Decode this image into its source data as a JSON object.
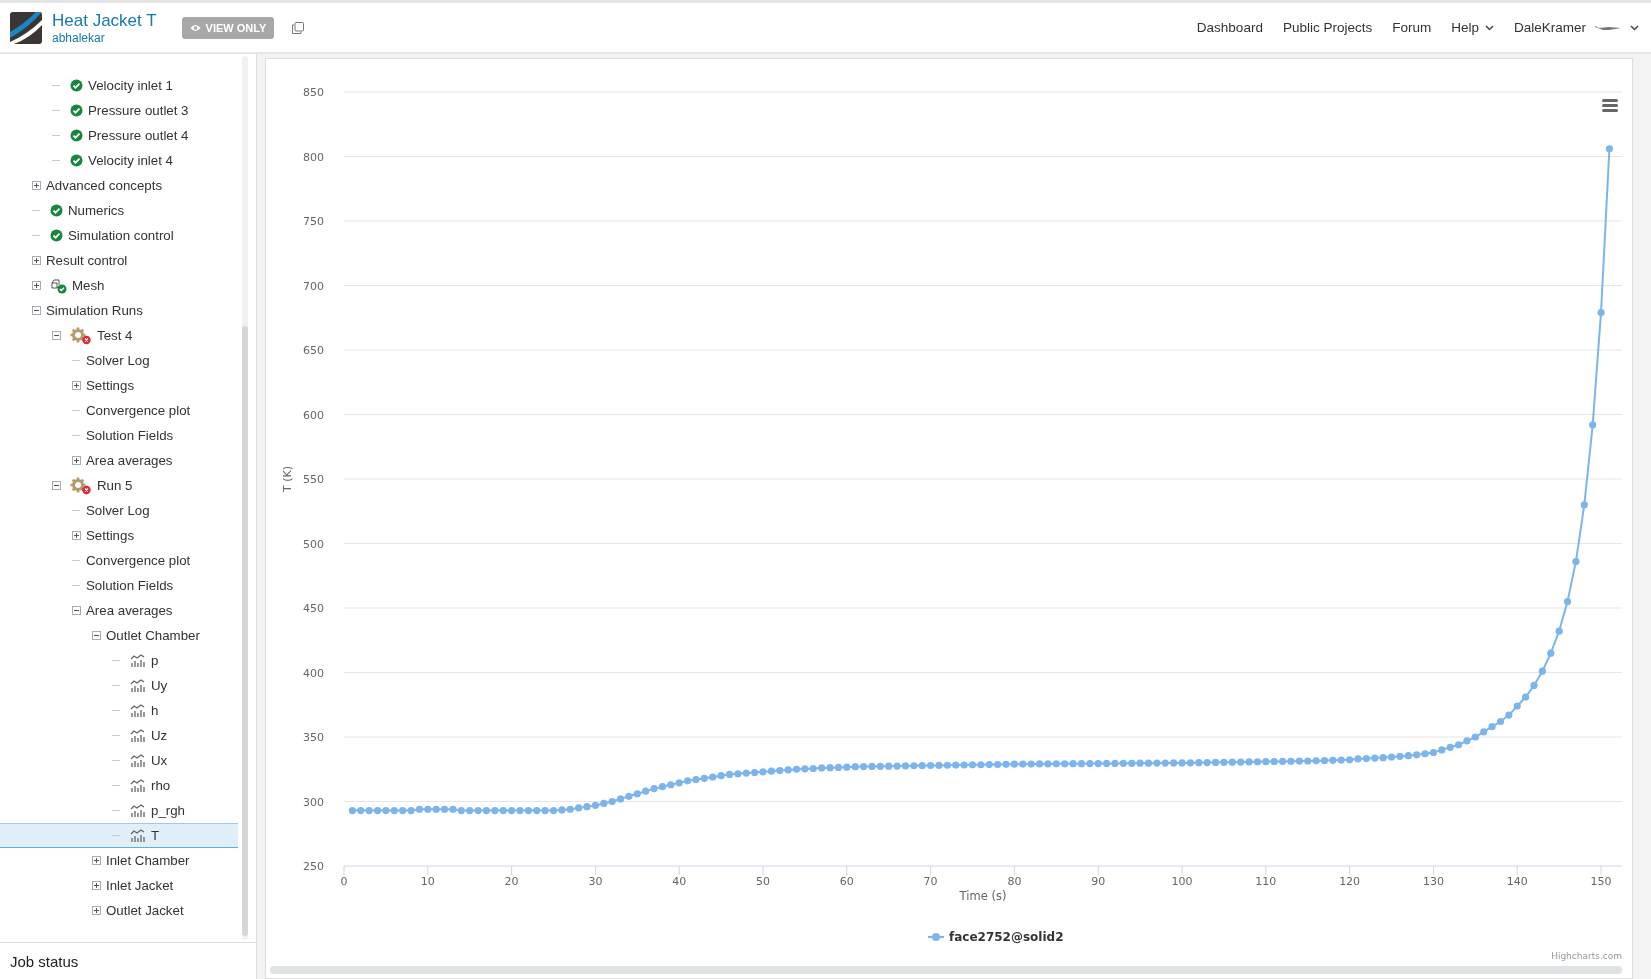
{
  "header": {
    "title": "Heat Jacket T",
    "subtitle": "abhalekar",
    "badge": "VIEW ONLY",
    "nav": [
      {
        "label": "Dashboard",
        "kind": "link"
      },
      {
        "label": "Public Projects",
        "kind": "link"
      },
      {
        "label": "Forum",
        "kind": "link"
      },
      {
        "label": "Help",
        "kind": "menu"
      },
      {
        "label": "DaleKramer",
        "kind": "user"
      }
    ]
  },
  "tree": {
    "items": [
      {
        "kind": "group",
        "children": [
          {
            "label": "Velocity inlet 1",
            "kind": "check",
            "selected": false
          },
          {
            "label": "Pressure outlet 3",
            "kind": "check",
            "selected": false
          },
          {
            "label": "Pressure outlet 4",
            "kind": "check",
            "selected": false
          },
          {
            "label": "Velocity inlet 4",
            "kind": "check",
            "selected": false
          }
        ]
      },
      {
        "label": "Advanced concepts",
        "expanded": false,
        "selected": false
      },
      {
        "label": "Numerics",
        "kind": "check",
        "selected": false
      },
      {
        "label": "Simulation control",
        "kind": "check",
        "selected": false
      },
      {
        "label": "Result control",
        "expanded": false,
        "selected": false
      },
      {
        "label": "Mesh",
        "kind": "mesh",
        "expanded": false,
        "selected": false
      },
      {
        "label": "Simulation Runs",
        "expanded": true,
        "selected": false,
        "children": [
          {
            "label": "Test 4",
            "kind": "run-error",
            "expanded": true,
            "selected": false,
            "children": [
              {
                "label": "Solver Log",
                "selected": false
              },
              {
                "label": "Settings",
                "expanded": false,
                "selected": false
              },
              {
                "label": "Convergence plot",
                "selected": false
              },
              {
                "label": "Solution Fields",
                "selected": false
              },
              {
                "label": "Area averages",
                "expanded": false,
                "selected": false
              }
            ]
          },
          {
            "label": "Run 5",
            "kind": "run-error",
            "expanded": true,
            "selected": false,
            "children": [
              {
                "label": "Solver Log",
                "selected": false
              },
              {
                "label": "Settings",
                "expanded": false,
                "selected": false
              },
              {
                "label": "Convergence plot",
                "selected": false
              },
              {
                "label": "Solution Fields",
                "selected": false
              },
              {
                "label": "Area averages",
                "expanded": true,
                "selected": false,
                "children": [
                  {
                    "label": "Outlet Chamber",
                    "expanded": true,
                    "selected": false,
                    "children": [
                      {
                        "label": "p",
                        "kind": "plot",
                        "selected": false
                      },
                      {
                        "label": "Uy",
                        "kind": "plot",
                        "selected": false
                      },
                      {
                        "label": "h",
                        "kind": "plot",
                        "selected": false
                      },
                      {
                        "label": "Uz",
                        "kind": "plot",
                        "selected": false
                      },
                      {
                        "label": "Ux",
                        "kind": "plot",
                        "selected": false
                      },
                      {
                        "label": "rho",
                        "kind": "plot",
                        "selected": false
                      },
                      {
                        "label": "p_rgh",
                        "kind": "plot",
                        "selected": false
                      },
                      {
                        "label": "T",
                        "kind": "plot",
                        "selected": true
                      }
                    ]
                  },
                  {
                    "label": "Inlet Chamber",
                    "expanded": false,
                    "selected": false
                  },
                  {
                    "label": "Inlet Jacket",
                    "expanded": false,
                    "selected": false
                  },
                  {
                    "label": "Outlet Jacket",
                    "expanded": false,
                    "selected": false
                  }
                ]
              }
            ]
          }
        ]
      }
    ]
  },
  "job_status": "Job status",
  "chart": {
    "credit": "Highcharts.com",
    "chart_data": {
      "type": "line",
      "grid": true,
      "xlabel": "Time (s)",
      "ylabel": "T (K)",
      "xlim": [
        0,
        152.5
      ],
      "ylim": [
        250,
        850
      ],
      "xticks": [
        0,
        10,
        20,
        30,
        40,
        50,
        60,
        70,
        80,
        90,
        100,
        110,
        120,
        130,
        140,
        150
      ],
      "yticks": [
        250,
        300,
        350,
        400,
        450,
        500,
        550,
        600,
        650,
        700,
        750,
        800,
        850
      ],
      "x": [
        1,
        2,
        3,
        4,
        5,
        6,
        7,
        8,
        9,
        10,
        11,
        12,
        13,
        14,
        15,
        16,
        17,
        18,
        19,
        20,
        21,
        22,
        23,
        24,
        25,
        26,
        27,
        28,
        29,
        30,
        31,
        32,
        33,
        34,
        35,
        36,
        37,
        38,
        39,
        40,
        41,
        42,
        43,
        44,
        45,
        46,
        47,
        48,
        49,
        50,
        51,
        52,
        53,
        54,
        55,
        56,
        57,
        58,
        59,
        60,
        61,
        62,
        63,
        64,
        65,
        66,
        67,
        68,
        69,
        70,
        71,
        72,
        73,
        74,
        75,
        76,
        77,
        78,
        79,
        80,
        81,
        82,
        83,
        84,
        85,
        86,
        87,
        88,
        89,
        90,
        91,
        92,
        93,
        94,
        95,
        96,
        97,
        98,
        99,
        100,
        101,
        102,
        103,
        104,
        105,
        106,
        107,
        108,
        109,
        110,
        111,
        112,
        113,
        114,
        115,
        116,
        117,
        118,
        119,
        120,
        121,
        122,
        123,
        124,
        125,
        126,
        127,
        128,
        129,
        130,
        131,
        132,
        133,
        134,
        135,
        136,
        137,
        138,
        139,
        140,
        141,
        142,
        143,
        144,
        145,
        146,
        147,
        148,
        149,
        150,
        151
      ],
      "series": [
        {
          "name": "face2752@solid2",
          "color": "#7cb5ec",
          "marker": true,
          "values": [
            293,
            293,
            293,
            293,
            293,
            293,
            293,
            293,
            294,
            294,
            294,
            294,
            294,
            293,
            293,
            293,
            293,
            293,
            293,
            293,
            293,
            293,
            293,
            293,
            293,
            293.5,
            294,
            295,
            296,
            297,
            298.5,
            300,
            302,
            304,
            306,
            308,
            310,
            311.5,
            313,
            314.5,
            316,
            317,
            318,
            319,
            320,
            321,
            321.5,
            322,
            322.5,
            323,
            323.5,
            324,
            324.5,
            325,
            325.3,
            325.6,
            326,
            326.2,
            326.4,
            326.6,
            327,
            327.1,
            327.2,
            327.3,
            327.4,
            327.5,
            327.6,
            327.7,
            327.8,
            327.9,
            328,
            328.1,
            328.2,
            328.3,
            328.4,
            328.5,
            328.6,
            328.7,
            328.8,
            328.9,
            329,
            329,
            329.1,
            329.1,
            329.2,
            329.2,
            329.3,
            329.3,
            329.4,
            329.4,
            329.5,
            329.5,
            329.6,
            329.6,
            329.7,
            329.7,
            329.8,
            329.8,
            329.9,
            329.9,
            330,
            330.1,
            330.2,
            330.3,
            330.4,
            330.5,
            330.6,
            330.7,
            330.8,
            330.9,
            331,
            331.1,
            331.2,
            331.3,
            331.4,
            331.5,
            331.7,
            331.9,
            332.1,
            332.3,
            333,
            333.3,
            333.7,
            334,
            334.5,
            335,
            335.5,
            336.2,
            337,
            338,
            340,
            342,
            344,
            347,
            350,
            354,
            358,
            362,
            367,
            374,
            381,
            390,
            401,
            415,
            432,
            455,
            486,
            530,
            592,
            679,
            806
          ]
        }
      ]
    }
  }
}
